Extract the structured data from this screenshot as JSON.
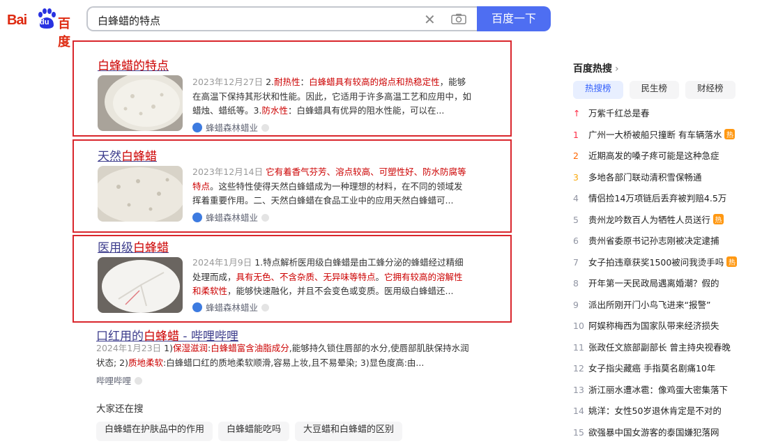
{
  "logo": {
    "latin": "Bai",
    "du": "du",
    "chinese": "百度"
  },
  "search": {
    "query": "白蜂蜡的特点",
    "button": "百度一下",
    "clear": "✕"
  },
  "results": [
    {
      "title_pre": "",
      "title_hl": "白蜂蜡的特点",
      "title_post": "",
      "date": "2023年12月27日",
      "segments": [
        {
          "t": " 2.",
          "h": false
        },
        {
          "t": "耐热性",
          "h": true
        },
        {
          "t": "：",
          "h": false
        },
        {
          "t": "白蜂蜡具有较高的熔点和热稳定性",
          "h": true
        },
        {
          "t": "，能够在高温下保持其形状和性能。因此，它适用于许多高温工艺和应用中，如蜡烛、蜡纸等。3.",
          "h": false
        },
        {
          "t": "防水性",
          "h": true
        },
        {
          "t": "：白蜂蜡具有优异的阻水性能，可以在...",
          "h": false
        }
      ],
      "source": "蜂蜡森林蜡业"
    },
    {
      "title_pre": "天然",
      "title_hl": "白蜂蜡",
      "title_post": "",
      "date": "2023年12月14日",
      "segments": [
        {
          "t": " ",
          "h": false
        },
        {
          "t": "它有着香气芬芳、溶点较高、可塑性好、防水防腐等特点",
          "h": true
        },
        {
          "t": "。这些特性使得天然白蜂蜡成为一种理想的材料，在不同的领域发挥着重要作用。二、天然白蜂蜡在食品工业中的应用天然白蜂蜡可...",
          "h": false
        }
      ],
      "source": "蜂蜡森林蜡业"
    },
    {
      "title_pre": "医用级",
      "title_hl": "白蜂蜡",
      "title_post": "",
      "date": "2024年1月9日",
      "segments": [
        {
          "t": " 1.特点解析医用级白蜂蜡是由工蜂分泌的蜂蜡经过精细处理而成，",
          "h": false
        },
        {
          "t": "具有无色、不含杂质、无异味等特点",
          "h": true
        },
        {
          "t": "。",
          "h": false
        },
        {
          "t": "它拥有较高的溶解性和柔软性",
          "h": true
        },
        {
          "t": "，能够快速融化，并且不会变色或变质。医用级白蜂蜡还...",
          "h": false
        }
      ],
      "source": "蜂蜡森林蜡业"
    }
  ],
  "plain_result": {
    "title_pre": "口红用的",
    "title_hl": "白蜂蜡",
    "title_post": " - 哔哩哔哩",
    "date": "2024年1月23日",
    "segments": [
      {
        "t": " 1)",
        "h": false
      },
      {
        "t": "保湿滋润",
        "h": true
      },
      {
        "t": ":",
        "h": false
      },
      {
        "t": "白蜂蜡富含油脂成分",
        "h": true
      },
      {
        "t": ",能够持久锁住唇部的水分,使唇部肌肤保持水润状态; 2)",
        "h": false
      },
      {
        "t": "质地柔软",
        "h": true
      },
      {
        "t": ":白蜂蜡口红的质地柔软顺滑,容易上妆,且不易晕染; 3)显色度高:由...",
        "h": false
      }
    ],
    "source": "哔哩哔哩"
  },
  "also_search": {
    "title": "大家还在搜",
    "items": [
      "白蜂蜡在护肤品中的作用",
      "白蜂蜡能吃吗",
      "大豆蜡和白蜂蜡的区别"
    ]
  },
  "hot": {
    "title": "百度热搜",
    "chevron": "›",
    "tabs": [
      "热搜榜",
      "民生榜",
      "财经榜"
    ],
    "active_tab": 0,
    "items": [
      {
        "rank": "↑",
        "text": "万紫千红总是春",
        "badge": ""
      },
      {
        "rank": "1",
        "text": "广州一大桥被船只撞断 有车辆落水",
        "badge": "热"
      },
      {
        "rank": "2",
        "text": "近期高发的嗓子疼可能是这种急症",
        "badge": ""
      },
      {
        "rank": "3",
        "text": "多地各部门联动清积雪保畅通",
        "badge": ""
      },
      {
        "rank": "4",
        "text": "情侣捡14万项链后丢弃被判赔4.5万",
        "badge": ""
      },
      {
        "rank": "5",
        "text": "贵州龙吟数百人为牺牲人员送行",
        "badge": "热"
      },
      {
        "rank": "6",
        "text": "贵州省委原书记孙志刚被决定逮捕",
        "badge": ""
      },
      {
        "rank": "7",
        "text": "女子拍违章获奖1500被问我烫手吗",
        "badge": "热"
      },
      {
        "rank": "8",
        "text": "开年第一天民政局遇离婚潮？假的",
        "badge": ""
      },
      {
        "rank": "9",
        "text": "派出所刚开门小鸟飞进来“报警”",
        "badge": ""
      },
      {
        "rank": "10",
        "text": "阿娱称梅西为国家队带来经济损失",
        "badge": ""
      },
      {
        "rank": "11",
        "text": "张政任文旅部副部长 曾主持央视春晚",
        "badge": ""
      },
      {
        "rank": "12",
        "text": "女子指尖藏癌 手指莫名剧痛10年",
        "badge": ""
      },
      {
        "rank": "13",
        "text": "浙江丽水遭冰雹：像鸡蛋大密集落下",
        "badge": ""
      },
      {
        "rank": "14",
        "text": "姚洋：女性50岁退休肯定是不对的",
        "badge": ""
      },
      {
        "rank": "15",
        "text": "欲强暴中国女游客的泰国嫌犯落网",
        "badge": ""
      }
    ]
  }
}
